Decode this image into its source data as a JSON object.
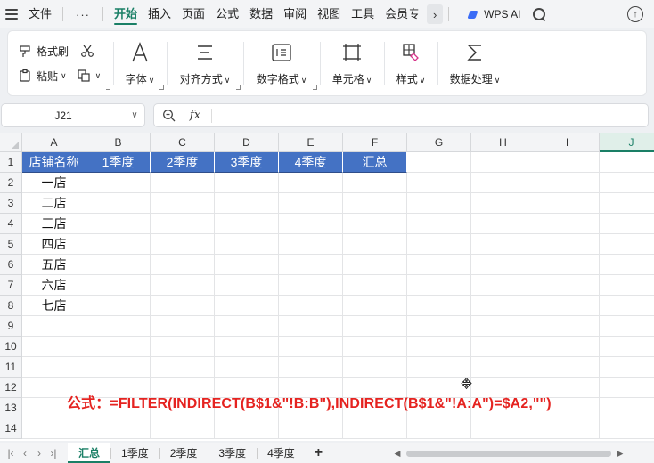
{
  "menubar": {
    "file_label": "文件",
    "more_label": "···",
    "tabs": [
      "开始",
      "插入",
      "页面",
      "公式",
      "数据",
      "审阅",
      "视图",
      "工具",
      "会员专"
    ],
    "active_tab": "开始",
    "wps_ai_label": "WPS AI"
  },
  "ribbon": {
    "format_painter": "格式刷",
    "paste": "粘贴",
    "font": "字体",
    "align": "对齐方式",
    "number_format": "数字格式",
    "cell": "单元格",
    "style": "样式",
    "data_processing": "数据处理"
  },
  "formula_bar": {
    "name_box": "J21",
    "fx": "fx",
    "value": ""
  },
  "sheet": {
    "columns": [
      "A",
      "B",
      "C",
      "D",
      "E",
      "F",
      "G",
      "H",
      "I",
      "J"
    ],
    "selected_column": "J",
    "rows": [
      "1",
      "2",
      "3",
      "4",
      "5",
      "6",
      "7",
      "8",
      "9",
      "10",
      "11",
      "12",
      "13",
      "14"
    ],
    "header_cells": [
      "店铺名称",
      "1季度",
      "2季度",
      "3季度",
      "4季度",
      "汇总"
    ],
    "store_names": [
      "一店",
      "二店",
      "三店",
      "四店",
      "五店",
      "六店",
      "七店"
    ],
    "formula_note": "公式：=FILTER(INDIRECT(B$1&\"!B:B\"),INDIRECT(B$1&\"!A:A\")=$A2,\"\")"
  },
  "sheet_tabs": {
    "tabs": [
      "汇总",
      "1季度",
      "2季度",
      "3季度",
      "4季度"
    ],
    "active": "汇总",
    "add_label": "+"
  },
  "colors": {
    "accent": "#1a7f66",
    "header_fill": "#4472c4",
    "formula_red": "#e52320"
  }
}
